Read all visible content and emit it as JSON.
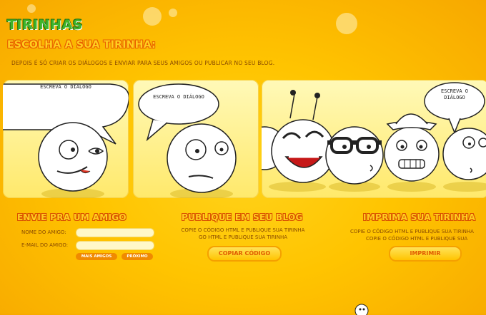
{
  "header": {
    "logo_text": "TIRINHAS",
    "title": "ESCOLHA A SUA TIRINHA:",
    "subtitle": "DEPOIS É SÓ CRIAR OS DIÁLOGOS E ENVIAR PARA SEUS AMIGOS OU PUBLICAR NO SEU BLOG."
  },
  "panels": [
    {
      "bubble_text": "ESCREVA O DIÁLOGO"
    },
    {
      "bubble_text": "ESCREVA O DIÁLOGO"
    },
    {
      "bubble_text": "ESCREVA O\nDIÁLOGO"
    }
  ],
  "send": {
    "title": "ENVIE PRA UM AMIGO",
    "name_label": "NOME DO AMIGO:",
    "email_label": "E-MAIL DO AMIGO:",
    "name_value": "",
    "email_value": "",
    "more_friends_label": "MAIS AMIGOS",
    "next_label": "PRÓXIMO"
  },
  "publish": {
    "title": "PUBLIQUE EM SEU BLOG",
    "desc_line1": "COPIE O CÓDIGO HTML E PUBLIQUE SUA TIRINHA",
    "desc_line2": "GO HTML E PUBLIQUE SUA TIRINHA",
    "button_label": "COPIAR CÓDIGO"
  },
  "print": {
    "title": "IMPRIMA SUA TIRINHA",
    "desc_line1": "COPIE O CÓDIGO HTML E PUBLIQUE SUA TIRINHA",
    "desc_line2": "COPIE O CÓDIGO HTML E PUBLIQUE SUA",
    "button_label": "IMPRIMIR"
  },
  "colors": {
    "accent": "#f08a00",
    "logo": "#3fb52a",
    "text": "#8a4b00"
  }
}
